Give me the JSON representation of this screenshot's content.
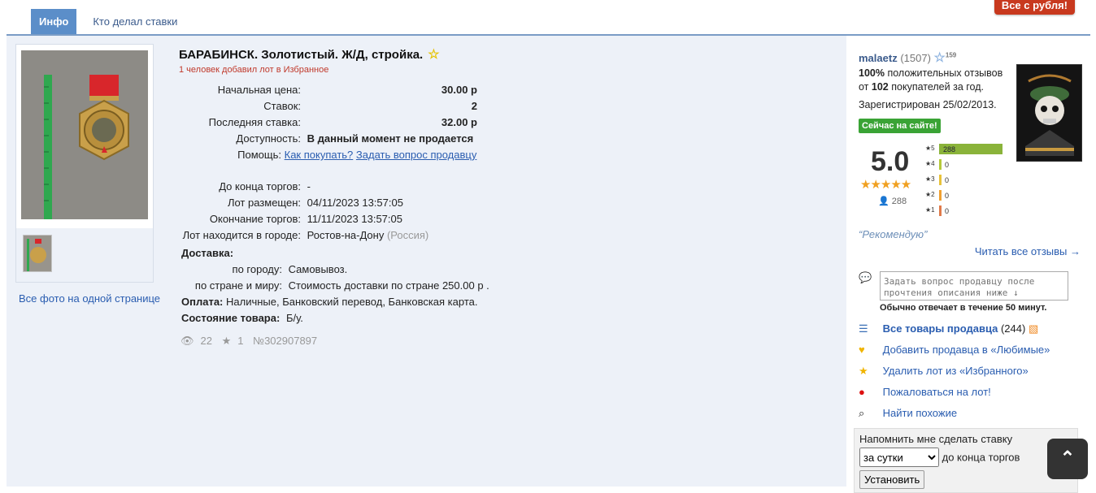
{
  "promo_button": "Все с рубля!",
  "tabs": [
    {
      "label": "Инфо",
      "active": true
    },
    {
      "label": "Кто делал ставки",
      "active": false
    }
  ],
  "lot": {
    "title": "БАРАБИНСК. Золотистый. Ж/Д, стройка.",
    "fav_note": "1 человек добавил лот в Избранное",
    "start_price_label": "Начальная цена:",
    "start_price": "30.00 р",
    "bids_label": "Ставок:",
    "bids": "2",
    "last_bid_label": "Последняя ставка:",
    "last_bid": "32.00 р",
    "availability_label": "Доступность:",
    "availability": "В данный момент не продается",
    "help_label": "Помощь:",
    "help_link_1": "Как покупать?",
    "help_link_2": "Задать вопрос продавцу",
    "ends_in_label": "До конца торгов:",
    "ends_in": "-",
    "posted_label": "Лот размещен:",
    "posted": "04/11/2023 13:57:05",
    "end_label": "Окончание торгов:",
    "end": "11/11/2023 13:57:05",
    "city_label": "Лот находится в городе:",
    "city": "Ростов-на-Дону",
    "country": "(Россия)",
    "delivery_label": "Доставка:",
    "delivery_city_label": "по городу:",
    "delivery_city": "Самовывоз.",
    "delivery_country_label": "по стране и миру:",
    "delivery_country": "Стоимость доставки по стране 250.00 р .",
    "payment_label": "Оплата:",
    "payment": "Наличные, Банковский перевод, Банковская карта.",
    "condition_label": "Состояние товара:",
    "condition": "Б/у.",
    "views": "22",
    "favorites": "1",
    "lot_number": "№302907897"
  },
  "photos": {
    "all_photos_link": "Все фото на одной странице"
  },
  "seller": {
    "name": "malaetz",
    "count": "(1507)",
    "star_sup": "159",
    "feedback_line1_bold": "100%",
    "feedback_line1": "положительных отзывов",
    "feedback_line2_pre": "от",
    "feedback_line2_bold": "102",
    "feedback_line2_post": "покупателей за год.",
    "registered": "Зарегистрирован 25/02/2013.",
    "online_badge": "Сейчас на сайте!",
    "rating": "5.0",
    "rating_count": "288",
    "bars": [
      {
        "star": "5",
        "count": "288",
        "fraction": 1.0,
        "color": "#8ab33a"
      },
      {
        "star": "4",
        "count": "0",
        "fraction": 0,
        "color": "#b5c93a"
      },
      {
        "star": "3",
        "count": "0",
        "fraction": 0,
        "color": "#e8c23a"
      },
      {
        "star": "2",
        "count": "0",
        "fraction": 0,
        "color": "#f0a030"
      },
      {
        "star": "1",
        "count": "0",
        "fraction": 0,
        "color": "#e07a4a"
      }
    ],
    "recommend": "“Рекомендую”",
    "read_all": "Читать все отзывы →",
    "ask_placeholder": "Задать вопрос продавцу после прочтения описания ниже ↓",
    "reply_note": "Обычно отвечает в течение 50 минут.",
    "all_items_label": "Все товары продавца",
    "all_items_count": "(244)",
    "add_favorite": "Добавить продавца в «Любимые»",
    "remove_lot": "Удалить лот из «Избранного»",
    "complain": "Пожаловаться на лот!",
    "find_similar": "Найти похожие"
  },
  "reminder": {
    "title": "Напомнить мне сделать ставку",
    "select_value": "за сутки",
    "suffix": "до конца торгов",
    "button": "Установить"
  },
  "colors": {
    "accent": "#5b8ec9",
    "link": "#2a5db0",
    "panel_bg": "#edf1f8",
    "promo": "#c8391e",
    "online": "#3aa335"
  }
}
